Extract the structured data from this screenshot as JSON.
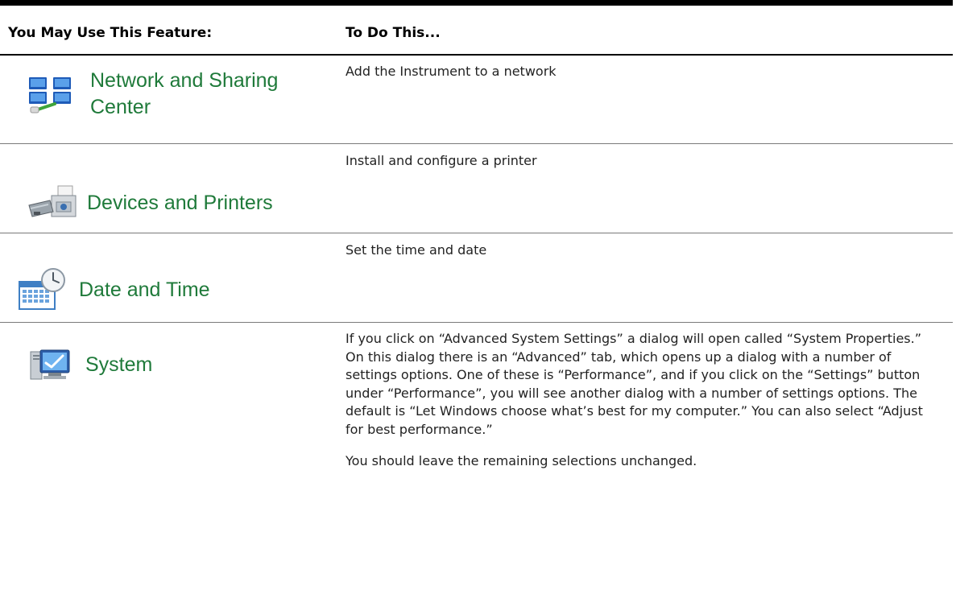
{
  "header": {
    "col1": "You May Use This Feature:",
    "col2": "To Do This..."
  },
  "colors": {
    "feature_text": "#1f7a3a",
    "rule": "#000000",
    "divider": "#7a7a7a"
  },
  "rows": [
    {
      "feature": {
        "icon": "network-and-sharing-icon",
        "label_line1": "Network and Sharing",
        "label_line2": "Center"
      },
      "description": [
        "Add the Instrument to a network"
      ]
    },
    {
      "feature": {
        "icon": "devices-and-printers-icon",
        "label": "Devices and Printers"
      },
      "description": [
        "Install and configure a printer"
      ]
    },
    {
      "feature": {
        "icon": "date-and-time-icon",
        "label": "Date and Time"
      },
      "description": [
        "Set the time and date"
      ]
    },
    {
      "feature": {
        "icon": "system-icon",
        "label": "System"
      },
      "description": [
        "If you click on “Advanced System Settings” a dialog will open called “System Properties.” On this dialog there is an “Advanced” tab, which opens up a dialog with a number of settings options. One of these is “Performance”, and if you click on the “Settings” button under “Performance”, you will see another dialog with a number of settings options.   The default is “Let Windows choose what’s best for my computer.” You can also select “Adjust for best performance.”",
        "You should leave the remaining selections unchanged."
      ]
    }
  ]
}
